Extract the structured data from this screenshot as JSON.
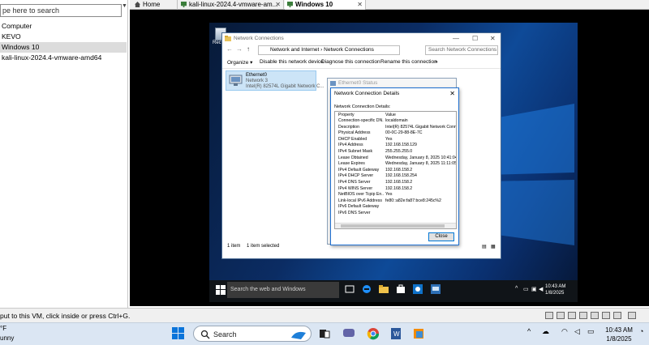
{
  "library": {
    "search_placeholder": "pe here to search",
    "items": [
      {
        "label": "Computer",
        "selected": false
      },
      {
        "label": "KEVO",
        "selected": false
      },
      {
        "label": "Windows 10",
        "selected": true
      },
      {
        "label": "kali-linux-2024.4-vmware-amd64",
        "selected": false
      }
    ]
  },
  "tabs": [
    {
      "label": "Home",
      "icon": "home-icon",
      "closable": false,
      "active": false
    },
    {
      "label": "kali-linux-2024.4-vmware-am...",
      "icon": "vm-icon",
      "closable": true,
      "active": false
    },
    {
      "label": "Windows 10",
      "icon": "vm-icon",
      "closable": true,
      "active": true
    }
  ],
  "vm": {
    "recycle_label": "Recy",
    "network_window": {
      "title": "Network Connections",
      "address": [
        "Network and Internet",
        "Network Connections"
      ],
      "search_placeholder": "Search Network Connections",
      "commands": [
        "Organize ▾",
        "Disable this network device",
        "Diagnose this connection",
        "Rename this connection",
        "»"
      ],
      "adapter": {
        "name": "Ethernet0",
        "network": "Network 3",
        "device": "Intel(R) 82574L Gigabit Network C..."
      },
      "status": {
        "items": "1 item",
        "selected": "1 item selected"
      }
    },
    "ethernet_status_title": "Ethernet0 Status",
    "details": {
      "title": "Network Connection Details",
      "subtitle": "Network Connection Details:",
      "columns": [
        "Property",
        "Value"
      ],
      "rows": [
        [
          "Connection-specific DN...",
          "localdomain"
        ],
        [
          "Description",
          "Intel(R) 82574L Gigabit Network Connect"
        ],
        [
          "Physical Address",
          "00-0C-29-88-8E-7C"
        ],
        [
          "DHCP Enabled",
          "Yes"
        ],
        [
          "IPv4 Address",
          "192.168.158.129"
        ],
        [
          "IPv4 Subnet Mask",
          "255.255.255.0"
        ],
        [
          "Lease Obtained",
          "Wednesday, January 8, 2025 10:41:04 A"
        ],
        [
          "Lease Expires",
          "Wednesday, January 8, 2025 11:11:05 A"
        ],
        [
          "IPv4 Default Gateway",
          "192.168.158.2"
        ],
        [
          "IPv4 DHCP Server",
          "192.168.158.254"
        ],
        [
          "IPv4 DNS Server",
          "192.168.158.2"
        ],
        [
          "IPv4 WINS Server",
          "192.168.158.2"
        ],
        [
          "NetBIOS over Tcpip En...",
          "Yes"
        ],
        [
          "Link-local IPv6 Address",
          "fe80::a82e:fa87:bce8:245c%2"
        ],
        [
          "IPv6 Default Gateway",
          ""
        ],
        [
          "IPv6 DNS Server",
          ""
        ]
      ],
      "close_label": "Close"
    },
    "taskbar": {
      "search_placeholder": "Search the web and Windows",
      "time": "10:43 AM",
      "date": "1/8/2025"
    }
  },
  "vmware_status": {
    "message": "put to this VM, click inside or press Ctrl+G."
  },
  "host_taskbar": {
    "weather_temp": "°F",
    "weather_desc": "unny",
    "search_label": "Search",
    "time": "10:43 AM",
    "date": "1/8/2025"
  },
  "colors": {
    "accent": "#0078d7",
    "vm_desktop": "#0b2c63",
    "selection": "#cce4f7"
  }
}
